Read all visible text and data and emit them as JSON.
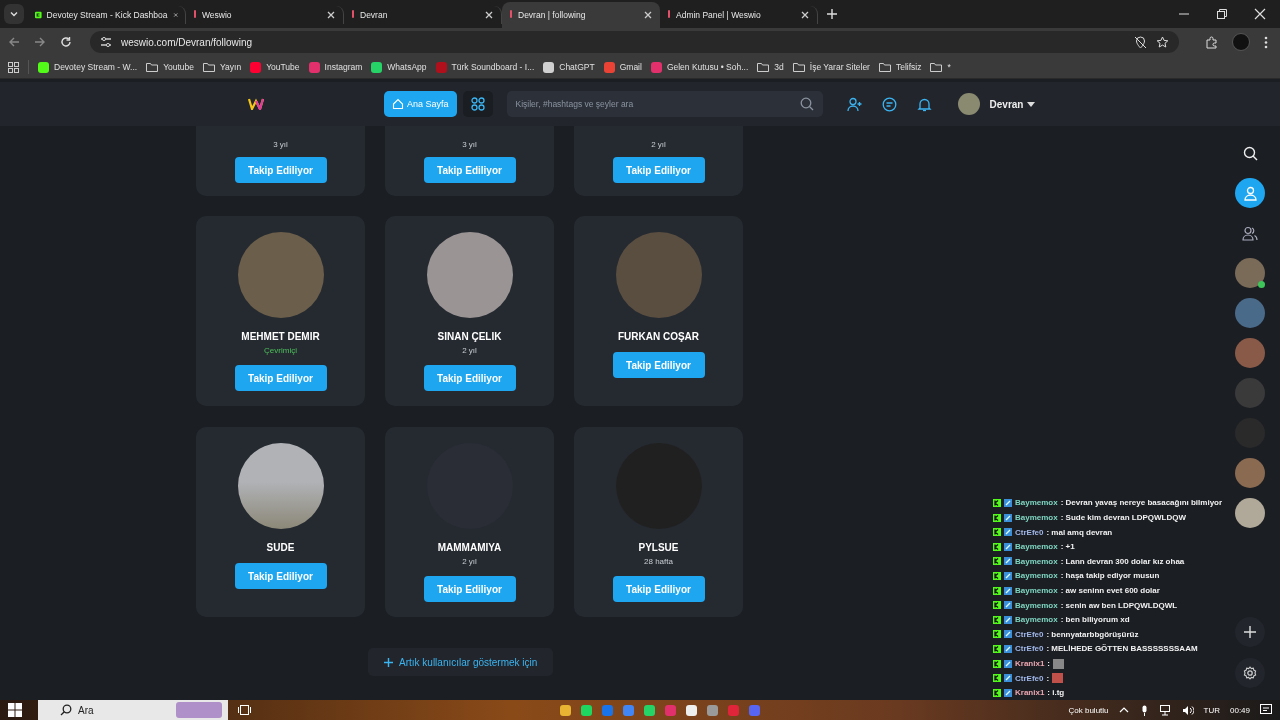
{
  "browser": {
    "tabs": [
      {
        "title": "Devotey Stream - Kick Dashboa",
        "kind": "kick",
        "selected": false
      },
      {
        "title": "Weswio",
        "kind": "site",
        "selected": false
      },
      {
        "title": "Devran",
        "kind": "site",
        "selected": false
      },
      {
        "title": "Devran | following",
        "kind": "site",
        "selected": true
      },
      {
        "title": "Admin Panel | Weswio",
        "kind": "site",
        "selected": false
      }
    ],
    "url": "weswio.com/Devran/following",
    "bookmarks": [
      {
        "label": "Devotey Stream - W...",
        "kind": "site",
        "color": "#53fc18"
      },
      {
        "label": "Youtube",
        "kind": "folder"
      },
      {
        "label": "Yayın",
        "kind": "folder"
      },
      {
        "label": "YouTube",
        "kind": "site",
        "color": "#ff0033"
      },
      {
        "label": "Instagram",
        "kind": "site",
        "color": "#e1306c"
      },
      {
        "label": "WhatsApp",
        "kind": "site",
        "color": "#25d366"
      },
      {
        "label": "Türk Soundboard - I...",
        "kind": "site",
        "color": "#b0101c"
      },
      {
        "label": "ChatGPT",
        "kind": "site",
        "color": "#d0d0d0"
      },
      {
        "label": "Gmail",
        "kind": "site",
        "color": "#ea4335"
      },
      {
        "label": "Gelen Kutusu • Soh...",
        "kind": "site",
        "color": "#e1306c"
      },
      {
        "label": "3d",
        "kind": "folder"
      },
      {
        "label": "İşe Yarar Siteler",
        "kind": "folder"
      },
      {
        "label": "Telifsiz",
        "kind": "folder"
      },
      {
        "label": "*",
        "kind": "folder"
      }
    ]
  },
  "header": {
    "home_button": "Ana Sayfa",
    "search": {
      "placeholder": "Kişiler, #hashtags ve şeyler ara"
    },
    "user": "Devran"
  },
  "cards_partial": [
    {
      "meta": "3 yıl",
      "button": "Takip Ediliyor"
    },
    {
      "meta": "3 yıl",
      "button": "Takip Ediliyor"
    },
    {
      "meta": "2 yıl",
      "button": "Takip Ediliyor"
    }
  ],
  "cards": [
    {
      "name": "MEHMET DEMIR",
      "meta": {
        "text": "Çevrimiçi",
        "kind": "status"
      },
      "button": "Takip Ediliyor"
    },
    {
      "name": "SINAN ÇELIK",
      "meta": {
        "text": "2 yıl",
        "kind": "age"
      },
      "button": "Takip Ediliyor"
    },
    {
      "name": "FURKAN COŞAR",
      "button": "Takip Ediliyor"
    },
    {
      "name": "SUDE",
      "button": "Takip Ediliyor"
    },
    {
      "name": "MAMMAMIYA",
      "meta": {
        "text": "2 yıl",
        "kind": "age"
      },
      "button": "Takip Ediliyor"
    },
    {
      "name": "PYLSUE",
      "meta": {
        "text": "28 hafta",
        "kind": "age"
      },
      "button": "Takip Ediliyor"
    }
  ],
  "load_more": "Artık kullanıcılar göstermek için",
  "rail": [
    {
      "kind": "search",
      "selected": false
    },
    {
      "kind": "user",
      "selected": true
    },
    {
      "kind": "users",
      "selected": false
    },
    {
      "kind": "avatar",
      "online": true
    },
    {
      "kind": "avatar",
      "online": false
    },
    {
      "kind": "avatar",
      "online": false
    },
    {
      "kind": "avatar",
      "online": false
    },
    {
      "kind": "avatar",
      "online": false
    },
    {
      "kind": "avatar",
      "online": false
    },
    {
      "kind": "avatar",
      "online": false
    }
  ],
  "chat": [
    {
      "user": "Baymemox",
      "color": "#7fd6c2",
      "kind": "text",
      "text": ": Devran yavaş nereye basacağını bilmiyor"
    },
    {
      "user": "Baymemox",
      "color": "#7fd6c2",
      "kind": "text",
      "text": ": Sude kim devran LDPQWLDQW"
    },
    {
      "user": "CtrEfe0",
      "color": "#9fb6e8",
      "kind": "text",
      "text": ": mal amq devran"
    },
    {
      "user": "Baymemox",
      "color": "#7fd6c2",
      "kind": "text",
      "text": ": +1"
    },
    {
      "user": "Baymemox",
      "color": "#7fd6c2",
      "kind": "text",
      "text": ": Lann devran 300 dolar kız ohaa"
    },
    {
      "user": "Baymemox",
      "color": "#7fd6c2",
      "kind": "text",
      "text": ": haşa takip ediyor musun"
    },
    {
      "user": "Baymemox",
      "color": "#7fd6c2",
      "kind": "text",
      "text": ": aw seninn evet 600 dolar"
    },
    {
      "user": "Baymemox",
      "color": "#7fd6c2",
      "kind": "text",
      "text": ": senin aw ben LDPQWLDQWL"
    },
    {
      "user": "Baymemox",
      "color": "#7fd6c2",
      "kind": "text",
      "text": ": ben biliyorum xd"
    },
    {
      "user": "CtrEfe0",
      "color": "#9fb6e8",
      "kind": "text",
      "text": ": bennyatarbbgörüşürüz"
    },
    {
      "user": "CtrEfe0",
      "color": "#9fb6e8",
      "kind": "text",
      "text": ": MELİHEDE GÖTTEN BASSSSSSSAAM"
    },
    {
      "user": "Kranix1",
      "color": "#eca6b0",
      "kind": "emote",
      "text": ":"
    },
    {
      "user": "CtrEfe0",
      "color": "#9fb6e8",
      "kind": "emote",
      "text": ":"
    },
    {
      "user": "Kranix1",
      "color": "#eca6b0",
      "kind": "text",
      "text": ": i.tg"
    }
  ],
  "taskbar": {
    "search": "Ara",
    "weather": "Çok bulutlu",
    "language": "TUR",
    "time": "00:49"
  }
}
